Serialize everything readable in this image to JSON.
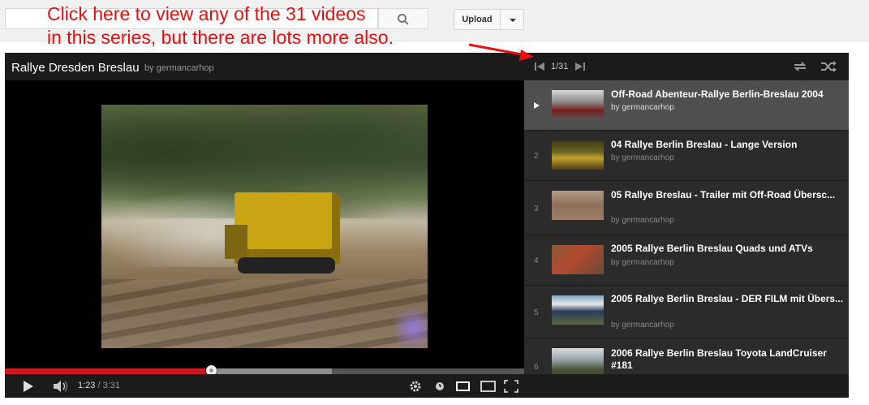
{
  "header": {
    "upload_label": "Upload"
  },
  "annotation": {
    "text": "Click here to view any of the 31 videos\nin this series, but there are lots more also."
  },
  "player": {
    "title": "Rallye Dresden Breslau",
    "by": "by germancarhop",
    "current_time": "1:23",
    "separator": "/",
    "duration": "3:31",
    "played_fraction": 0.397,
    "loaded_fraction": 0.63
  },
  "playlist": {
    "position": "1/31",
    "items": [
      {
        "index": "",
        "title": "Off-Road Abenteur-Rallye Berlin-Breslau 2004",
        "by": "by germancarhop",
        "active": true
      },
      {
        "index": "2",
        "title": "04 Rallye Berlin Breslau - Lange Version",
        "by": "by germancarhop",
        "active": false
      },
      {
        "index": "3",
        "title": "05 Rallye Breslau - Trailer mit Off-Road Übersc...",
        "by": "by germancarhop",
        "active": false
      },
      {
        "index": "4",
        "title": "2005 Rallye Berlin Breslau Quads und ATVs",
        "by": "by germancarhop",
        "active": false
      },
      {
        "index": "5",
        "title": "2005 Rallye Berlin Breslau - DER FILM mit Übers...",
        "by": "by germancarhop",
        "active": false
      },
      {
        "index": "6",
        "title": "2006 Rallye Berlin Breslau Toyota LandCruiser #181",
        "by": "",
        "active": false
      }
    ]
  },
  "icons": {
    "search": "search-icon",
    "prev": "skip-previous-icon",
    "next": "skip-next-icon",
    "loop": "loop-icon",
    "shuffle": "shuffle-icon",
    "play": "play-icon",
    "volume": "volume-icon",
    "settings": "gear-icon",
    "watch_later": "clock-icon",
    "small_player": "small-player-icon",
    "large_player": "large-player-icon",
    "fullscreen": "fullscreen-icon"
  },
  "colors": {
    "annotation": "#e8100f",
    "progress_played": "#cc181e",
    "player_bg": "#1b1b1b",
    "playlist_bg": "#2b2b2b",
    "active_item_bg": "#4f4f4f"
  }
}
